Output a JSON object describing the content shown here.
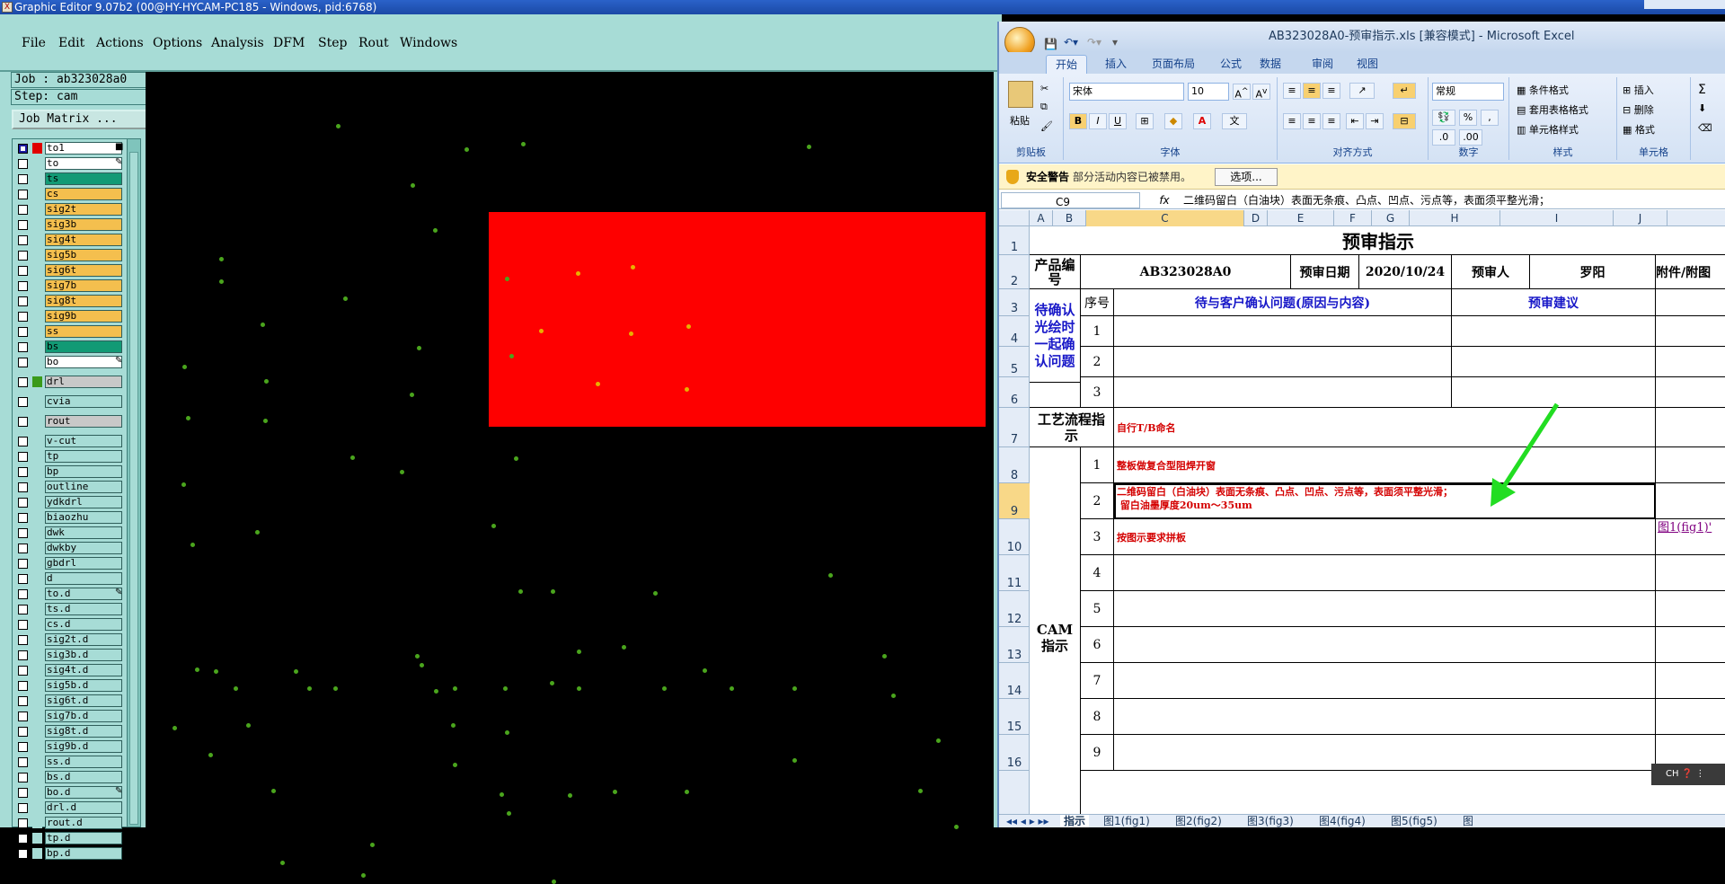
{
  "graphic_editor": {
    "title": "Graphic Editor 9.07b2 (00@HY-HYCAM-PC185 - Windows, pid:6768)",
    "menus": [
      "File",
      "Edit",
      "Actions",
      "Options",
      "Analysis",
      "DFM",
      "Step",
      "Rout",
      "Windows"
    ],
    "job_label": "Job : ab323028a0",
    "step_label": "Step: cam",
    "job_matrix_label": "Job Matrix ...",
    "layers": [
      {
        "name": "to1",
        "style": "white",
        "checked": true,
        "color": "#e00000",
        "mark": "■"
      },
      {
        "name": "to",
        "style": "white",
        "checked": false,
        "color": "",
        "mark": "✎"
      },
      {
        "name": "ts",
        "style": "green",
        "checked": false,
        "color": "",
        "mark": ""
      },
      {
        "name": "cs",
        "style": "board",
        "checked": false,
        "color": "",
        "mark": ""
      },
      {
        "name": "sig2t",
        "style": "board",
        "checked": false,
        "color": "",
        "mark": ""
      },
      {
        "name": "sig3b",
        "style": "board",
        "checked": false,
        "color": "",
        "mark": ""
      },
      {
        "name": "sig4t",
        "style": "board",
        "checked": false,
        "color": "",
        "mark": ""
      },
      {
        "name": "sig5b",
        "style": "board",
        "checked": false,
        "color": "",
        "mark": ""
      },
      {
        "name": "sig6t",
        "style": "board",
        "checked": false,
        "color": "",
        "mark": ""
      },
      {
        "name": "sig7b",
        "style": "board",
        "checked": false,
        "color": "",
        "mark": ""
      },
      {
        "name": "sig8t",
        "style": "board",
        "checked": false,
        "color": "",
        "mark": ""
      },
      {
        "name": "sig9b",
        "style": "board",
        "checked": false,
        "color": "",
        "mark": ""
      },
      {
        "name": "ss",
        "style": "board",
        "checked": false,
        "color": "",
        "mark": ""
      },
      {
        "name": "bs",
        "style": "green",
        "checked": false,
        "color": "",
        "mark": ""
      },
      {
        "name": "bo",
        "style": "white",
        "checked": false,
        "color": "",
        "mark": "✎"
      },
      {
        "name": "drl",
        "style": "grey",
        "checked": false,
        "color": "#3a9a1a",
        "mark": "",
        "gap": true
      },
      {
        "name": "cvia",
        "style": "cyan",
        "checked": false,
        "color": "",
        "mark": "",
        "gap": true
      },
      {
        "name": "rout",
        "style": "grey",
        "checked": false,
        "color": "",
        "mark": "",
        "gap": true
      },
      {
        "name": "v-cut",
        "style": "cyan",
        "checked": false,
        "color": "",
        "mark": "",
        "gap": true
      },
      {
        "name": "tp",
        "style": "cyan",
        "checked": false,
        "color": "",
        "mark": ""
      },
      {
        "name": "bp",
        "style": "cyan",
        "checked": false,
        "color": "",
        "mark": ""
      },
      {
        "name": "outline",
        "style": "cyan",
        "checked": false,
        "color": "",
        "mark": ""
      },
      {
        "name": "ydkdrl",
        "style": "cyan",
        "checked": false,
        "color": "",
        "mark": ""
      },
      {
        "name": "biaozhu",
        "style": "cyan",
        "checked": false,
        "color": "",
        "mark": ""
      },
      {
        "name": "dwk",
        "style": "cyan",
        "checked": false,
        "color": "",
        "mark": ""
      },
      {
        "name": "dwkby",
        "style": "cyan",
        "checked": false,
        "color": "",
        "mark": ""
      },
      {
        "name": "gbdrl",
        "style": "cyan",
        "checked": false,
        "color": "",
        "mark": ""
      },
      {
        "name": "d",
        "style": "cyan",
        "checked": false,
        "color": "",
        "mark": ""
      },
      {
        "name": "to.d",
        "style": "cyan",
        "checked": false,
        "color": "",
        "mark": "✎"
      },
      {
        "name": "ts.d",
        "style": "cyan",
        "checked": false,
        "color": "",
        "mark": ""
      },
      {
        "name": "cs.d",
        "style": "cyan",
        "checked": false,
        "color": "",
        "mark": ""
      },
      {
        "name": "sig2t.d",
        "style": "cyan",
        "checked": false,
        "color": "",
        "mark": ""
      },
      {
        "name": "sig3b.d",
        "style": "cyan",
        "checked": false,
        "color": "",
        "mark": ""
      },
      {
        "name": "sig4t.d",
        "style": "cyan",
        "checked": false,
        "color": "",
        "mark": ""
      },
      {
        "name": "sig5b.d",
        "style": "cyan",
        "checked": false,
        "color": "",
        "mark": ""
      },
      {
        "name": "sig6t.d",
        "style": "cyan",
        "checked": false,
        "color": "",
        "mark": ""
      },
      {
        "name": "sig7b.d",
        "style": "cyan",
        "checked": false,
        "color": "",
        "mark": ""
      },
      {
        "name": "sig8t.d",
        "style": "cyan",
        "checked": false,
        "color": "",
        "mark": ""
      },
      {
        "name": "sig9b.d",
        "style": "cyan",
        "checked": false,
        "color": "",
        "mark": ""
      },
      {
        "name": "ss.d",
        "style": "cyan",
        "checked": false,
        "color": "",
        "mark": ""
      },
      {
        "name": "bs.d",
        "style": "cyan",
        "checked": false,
        "color": "",
        "mark": ""
      },
      {
        "name": "bo.d",
        "style": "cyan",
        "checked": false,
        "color": "",
        "mark": "✎"
      },
      {
        "name": "drl.d",
        "style": "cyan",
        "checked": false,
        "color": "",
        "mark": ""
      },
      {
        "name": "rout.d",
        "style": "cyan",
        "checked": false,
        "color": "",
        "mark": ""
      },
      {
        "name": "tp.d",
        "style": "cyan",
        "checked": false,
        "color": "",
        "mark": ""
      },
      {
        "name": "bp.d",
        "style": "cyan",
        "checked": false,
        "color": "",
        "mark": ""
      }
    ],
    "colors": {
      "board": "#f4bf4e",
      "green_layer": "#129a75",
      "canvas": "#000000",
      "pad": "#4aa51d",
      "highlight_block": "#fe0000",
      "highlight_pad": "#e8b000"
    }
  },
  "excel": {
    "title": "AB323028A0-预审指示.xls  [兼容模式] - Microsoft Excel",
    "tabs": [
      "开始",
      "插入",
      "页面布局",
      "公式",
      "数据",
      "审阅",
      "视图"
    ],
    "ribbon": {
      "paste": "粘贴",
      "clipboard": "剪贴板",
      "font_name": "宋体",
      "font_size": "10",
      "font_group": "字体",
      "align_group": "对齐方式",
      "number_format": "常规",
      "number_group": "数字",
      "cond_format": "条件格式",
      "table_format": "套用表格格式",
      "cell_style": "单元格样式",
      "style_group": "样式",
      "insert": "插入",
      "delete": "删除",
      "format": "格式",
      "cells_group": "单元格"
    },
    "security": {
      "title": "安全警告",
      "message": "部分活动内容已被禁用。",
      "options": "选项..."
    },
    "name_box": "C9",
    "formula": "二维码留白（白油块）表面无条痕、凸点、凹点、污点等，表面须平整光滑；",
    "columns": [
      "A",
      "B",
      "C",
      "D",
      "E",
      "F",
      "G",
      "H",
      "I",
      "J"
    ],
    "rows": [
      "1",
      "2",
      "3",
      "4",
      "5",
      "6",
      "7",
      "8",
      "9",
      "10",
      "11",
      "12",
      "13",
      "14",
      "15",
      "16"
    ],
    "cells": {
      "title": "预审指示",
      "product_no_label": "产品编号",
      "product_no": "AB323028A0",
      "review_date_label": "预审日期",
      "review_date": "2020/10/24",
      "reviewer_label": "预审人",
      "reviewer": "罗阳",
      "attachment_label": "附件/附图",
      "seq_label": "序号",
      "issue_header": "待与客户确认问题(原因与内容)",
      "suggestion_header": "预审建议",
      "pending_label": "待确认光绘时一起确认问题",
      "pending_nums": [
        "1",
        "2",
        "3"
      ],
      "process_label": "工艺流程指示",
      "process_text": "自行T/B命名",
      "cam_label": "CAM指示",
      "cam_nums": [
        "1",
        "2",
        "3",
        "4",
        "5",
        "6",
        "7",
        "8",
        "9"
      ],
      "cam_items": [
        "整板做复合型阻焊开窗",
        "二维码留白（白油块）表面无条痕、凸点、凹点、污点等，表面须平整光滑；\n 留白油墨厚度20um～35um",
        "按图示要求拼板",
        "",
        "",
        "",
        "",
        "",
        ""
      ],
      "fig_link": "图1(fig1)'"
    },
    "sheet_tabs": [
      "指示",
      "图1(fig1)",
      "图2(fig2)",
      "图3(fig3)",
      "图4(fig4)",
      "图5(fig5)",
      "图"
    ],
    "ime": "CH"
  }
}
